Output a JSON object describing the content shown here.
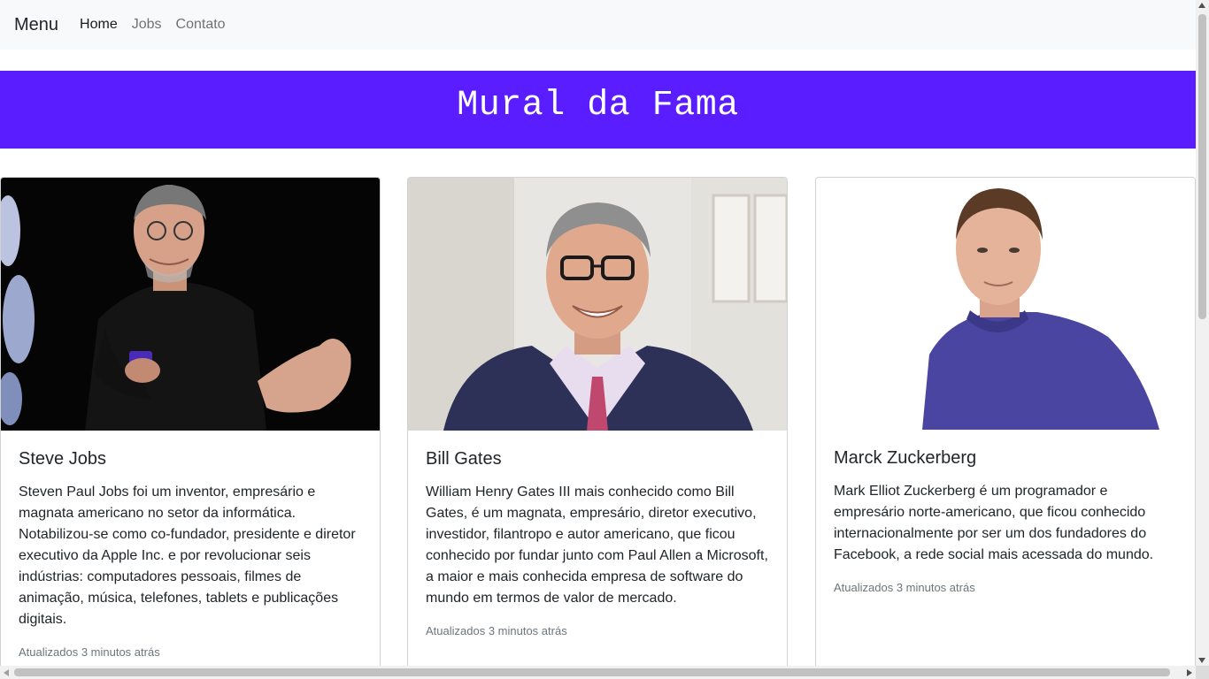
{
  "navbar": {
    "brand": "Menu",
    "links": [
      {
        "label": "Home",
        "active": true
      },
      {
        "label": "Jobs",
        "active": false
      },
      {
        "label": "Contato",
        "active": false
      }
    ]
  },
  "hero": {
    "title": "Mural da Fama",
    "background_color": "#5a1dff"
  },
  "cards": [
    {
      "title": "Steve Jobs",
      "image_alt": "steve-jobs-photo",
      "text": "Steven Paul Jobs foi um inventor, empresário e magnata americano no setor da informática. Notabilizou-se como co-fundador, presidente e diretor executivo da Apple Inc. e por revolucionar seis indústrias: computadores pessoais, filmes de animação, música, telefones, tablets e publicações digitais.",
      "updated": "Atualizados 3 minutos atrás"
    },
    {
      "title": "Bill Gates",
      "image_alt": "bill-gates-photo",
      "text": "William Henry Gates III mais conhecido como Bill Gates, é um magnata, empresário, diretor executivo, investidor, filantropo e autor americano, que ficou conhecido por fundar junto com Paul Allen a Microsoft, a maior e mais conhecida empresa de software do mundo em termos de valor de mercado.",
      "updated": "Atualizados 3 minutos atrás"
    },
    {
      "title": "Marck Zuckerberg",
      "image_alt": "mark-zuckerberg-photo",
      "text": "Mark Elliot Zuckerberg é um programador e empresário norte-americano, que ficou conhecido internacionalmente por ser um dos fundadores do Facebook, a rede social mais acessada do mundo.",
      "updated": "Atualizados 3 minutos atrás"
    }
  ]
}
